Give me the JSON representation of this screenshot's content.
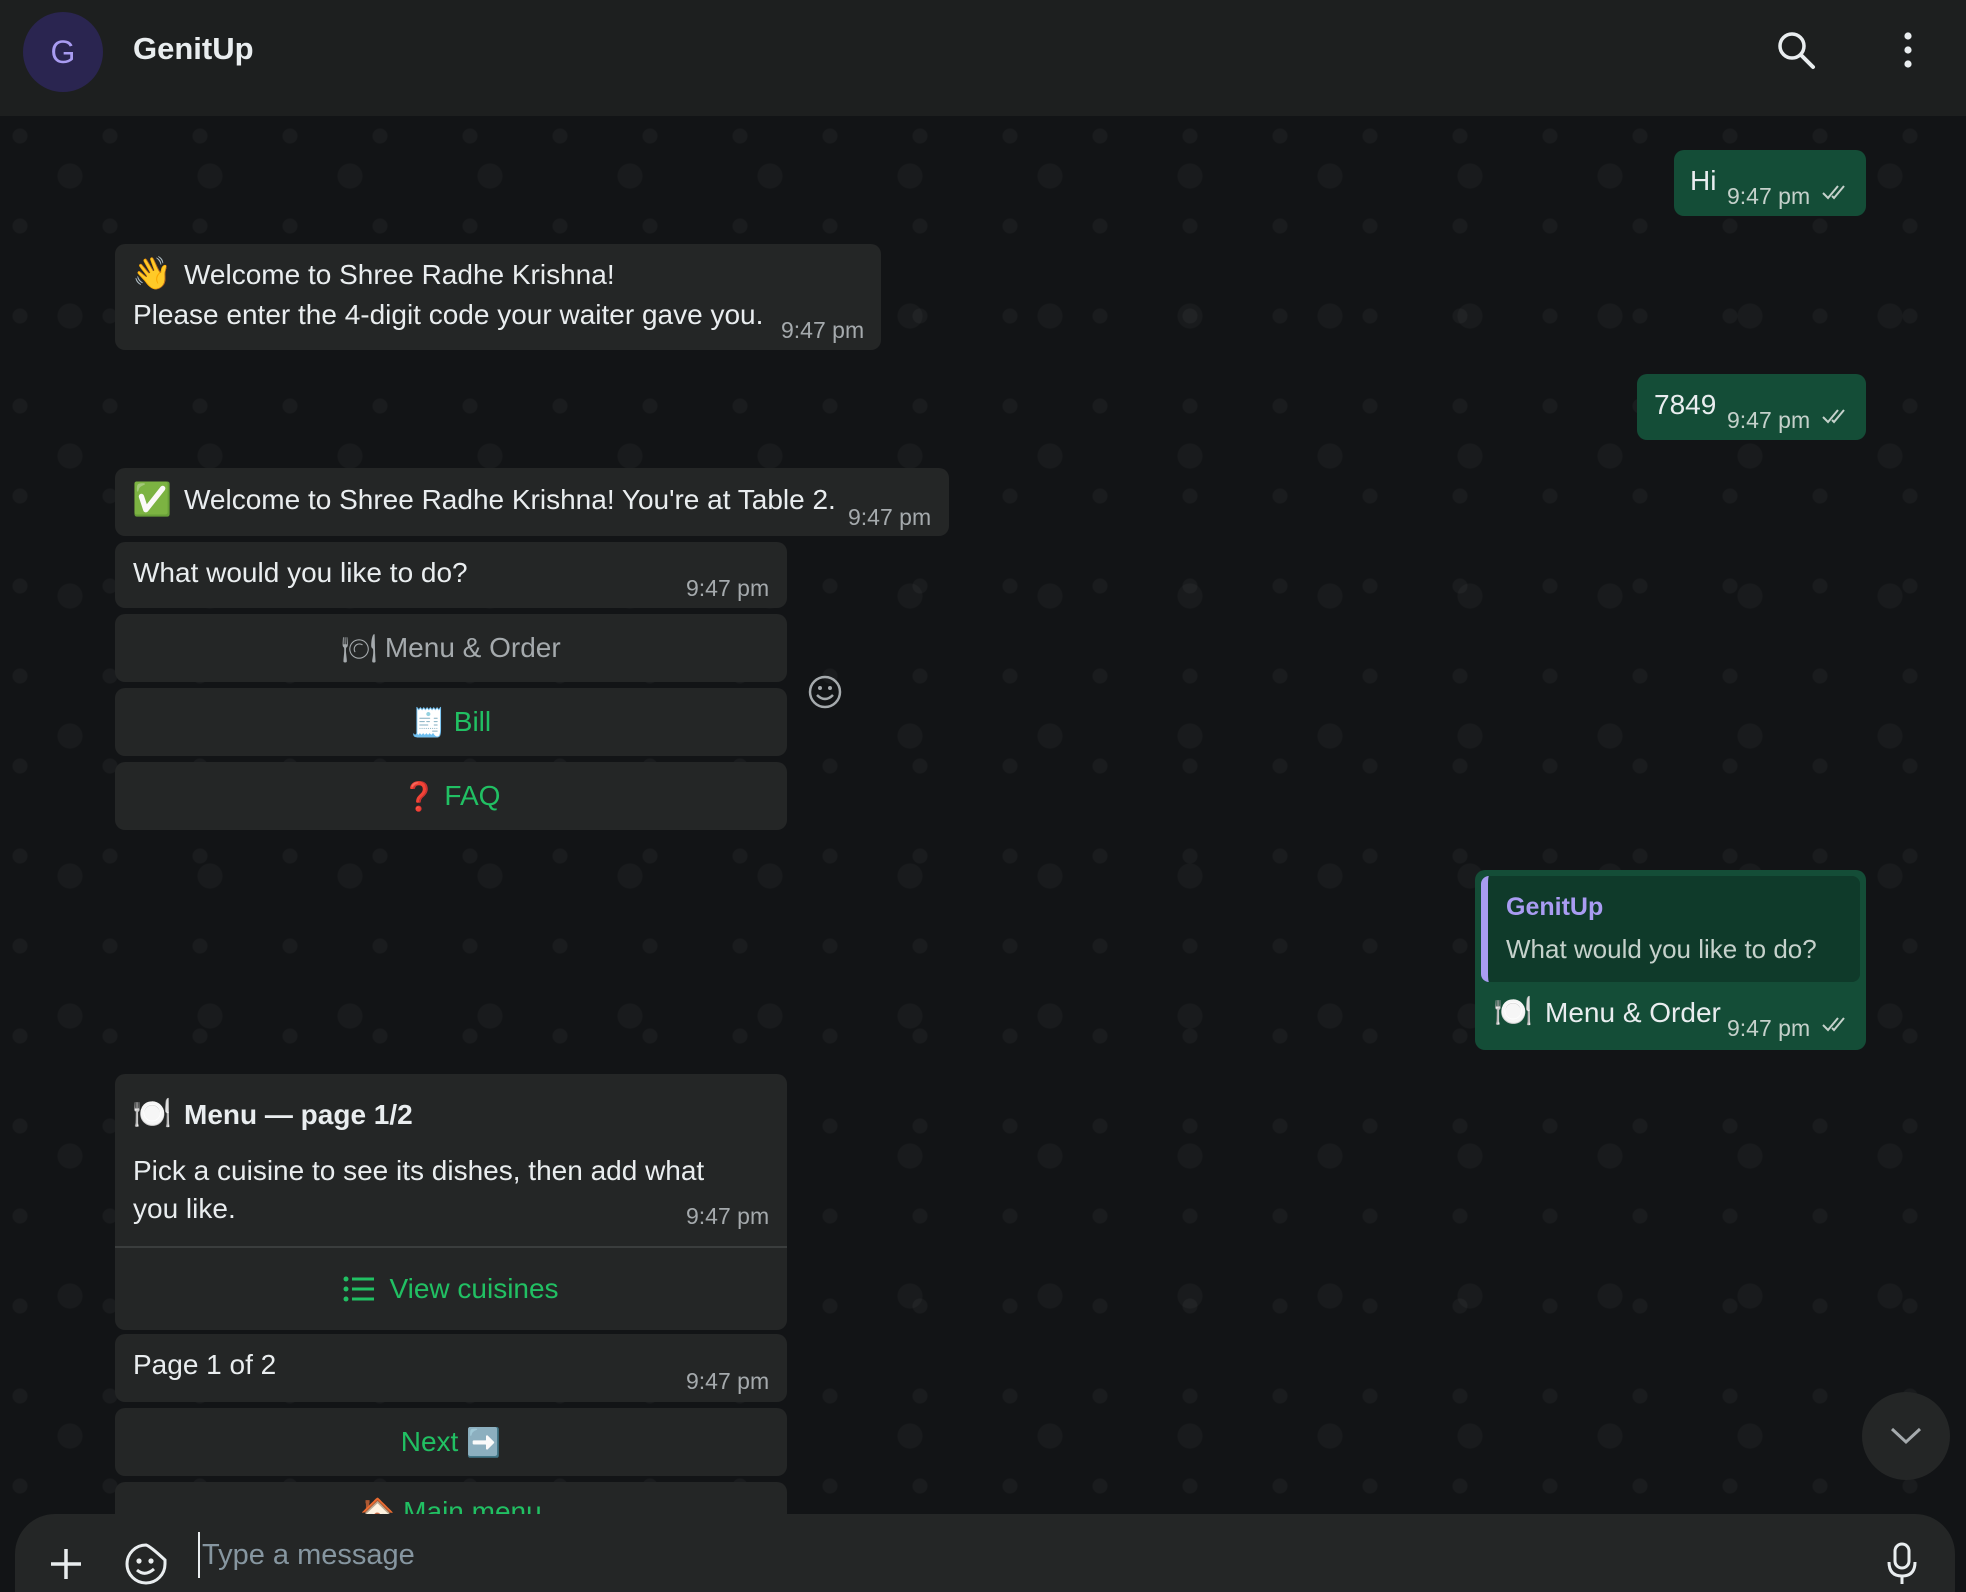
{
  "header": {
    "avatar_letter": "G",
    "contact_name": "GenitUp",
    "search_icon": "search-icon",
    "menu_icon": "kebab-menu-icon"
  },
  "messages": {
    "out_hi": {
      "text": "Hi",
      "time": "9:47 pm"
    },
    "in_welcome": {
      "emoji": "👋",
      "line1": "Welcome to Shree Radhe Krishna!",
      "line2": "Please enter the 4-digit code your waiter gave you.",
      "time": "9:47 pm"
    },
    "out_code": {
      "text": "7849",
      "time": "9:47 pm"
    },
    "in_table": {
      "emoji": "✅",
      "text": "Welcome to Shree Radhe Krishna! You're at Table 2.",
      "time": "9:47 pm"
    },
    "in_question": {
      "text": "What would you like to do?",
      "time": "9:47 pm"
    },
    "buttons": [
      {
        "emoji": "🍽",
        "label": "Menu & Order"
      },
      {
        "emoji": "🧾",
        "label": "Bill"
      },
      {
        "emoji": "❓",
        "label": "FAQ"
      }
    ],
    "out_reply": {
      "quote_author": "GenitUp",
      "quote_text": "What would you like to do?",
      "emoji": "🍽️",
      "text": "Menu & Order",
      "time": "9:47 pm"
    },
    "in_menu": {
      "emoji": "🍽️",
      "title": "Menu — page 1/2",
      "body": "Pick a cuisine to see its dishes, then add what you like.",
      "time": "9:47 pm",
      "action": "View cuisines"
    },
    "in_page": {
      "text": "Page 1 of 2",
      "time": "9:47 pm"
    },
    "next_button": {
      "label": "Next",
      "emoji": "➡️"
    },
    "main_menu_button": {
      "emoji": "🏠",
      "label": "Main menu"
    }
  },
  "composer": {
    "placeholder": "Type a message",
    "add_icon": "plus-icon",
    "sticker_icon": "sticker-icon",
    "mic_icon": "microphone-icon"
  },
  "colors": {
    "background": "#121416",
    "header": "#1d1f1f",
    "incoming_bubble": "#242626",
    "outgoing_bubble": "#144d37",
    "accent_green": "#21c063",
    "quote_author": "#a99cf2"
  }
}
